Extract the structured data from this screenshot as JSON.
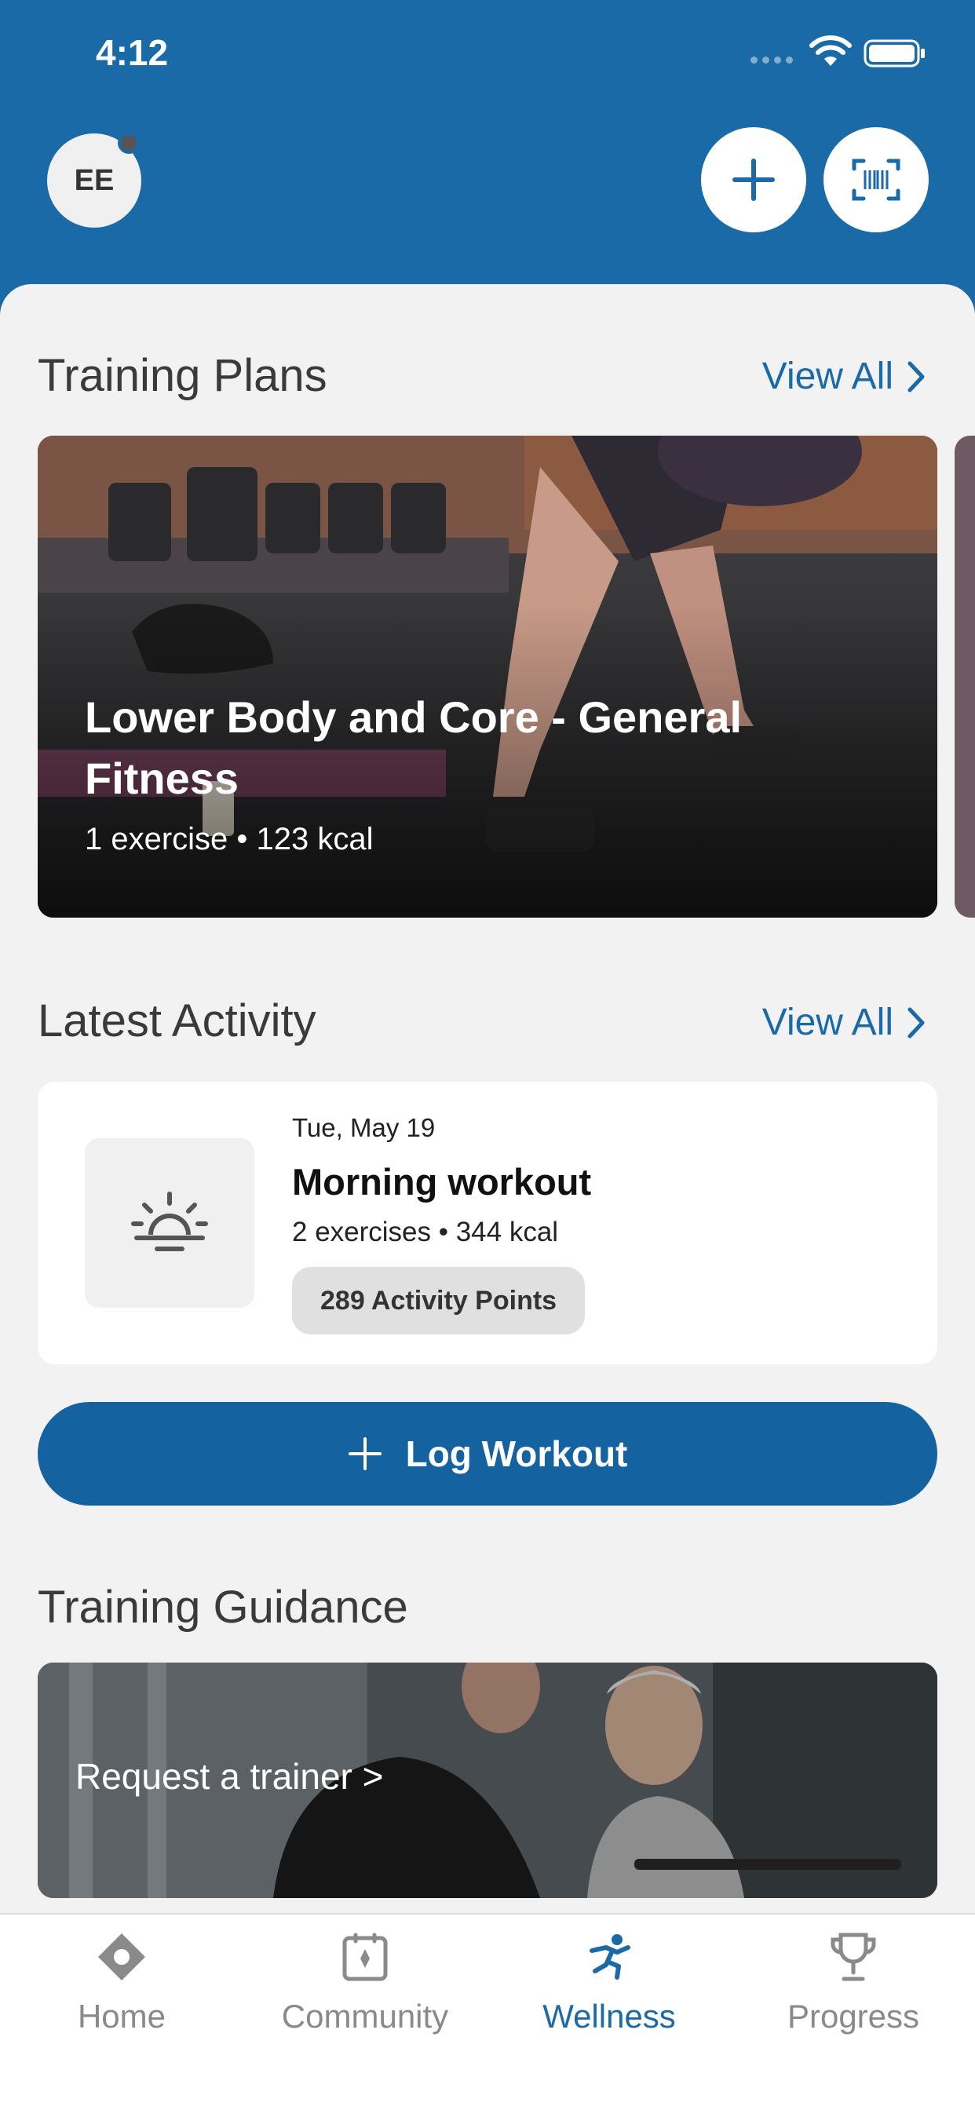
{
  "status_bar": {
    "time": "4:12"
  },
  "header": {
    "avatar_initials": "EE",
    "add_icon": "plus-icon",
    "scan_icon": "barcode-scan-icon"
  },
  "training_plans": {
    "title": "Training Plans",
    "view_all": "View All",
    "card": {
      "title": "Lower Body and Core - General Fitness",
      "subtitle": "1 exercise • 123 kcal"
    }
  },
  "latest_activity": {
    "title": "Latest Activity",
    "view_all": "View All",
    "item": {
      "date": "Tue, May 19",
      "title": "Morning workout",
      "subtitle": "2 exercises • 344 kcal",
      "badge": "289 Activity Points",
      "icon": "sunrise-icon"
    }
  },
  "log_workout": {
    "label": "Log Workout"
  },
  "training_guidance": {
    "title": "Training Guidance",
    "card_text": "Request a trainer >"
  },
  "tabbar": {
    "tabs": [
      {
        "label": "Home",
        "icon": "home-icon",
        "active": false
      },
      {
        "label": "Community",
        "icon": "community-icon",
        "active": false
      },
      {
        "label": "Wellness",
        "icon": "wellness-icon",
        "active": true
      },
      {
        "label": "Progress",
        "icon": "trophy-icon",
        "active": false
      }
    ]
  },
  "colors": {
    "brand": "#1a6aa8",
    "button": "#1562a0",
    "background": "#f2f2f2"
  }
}
